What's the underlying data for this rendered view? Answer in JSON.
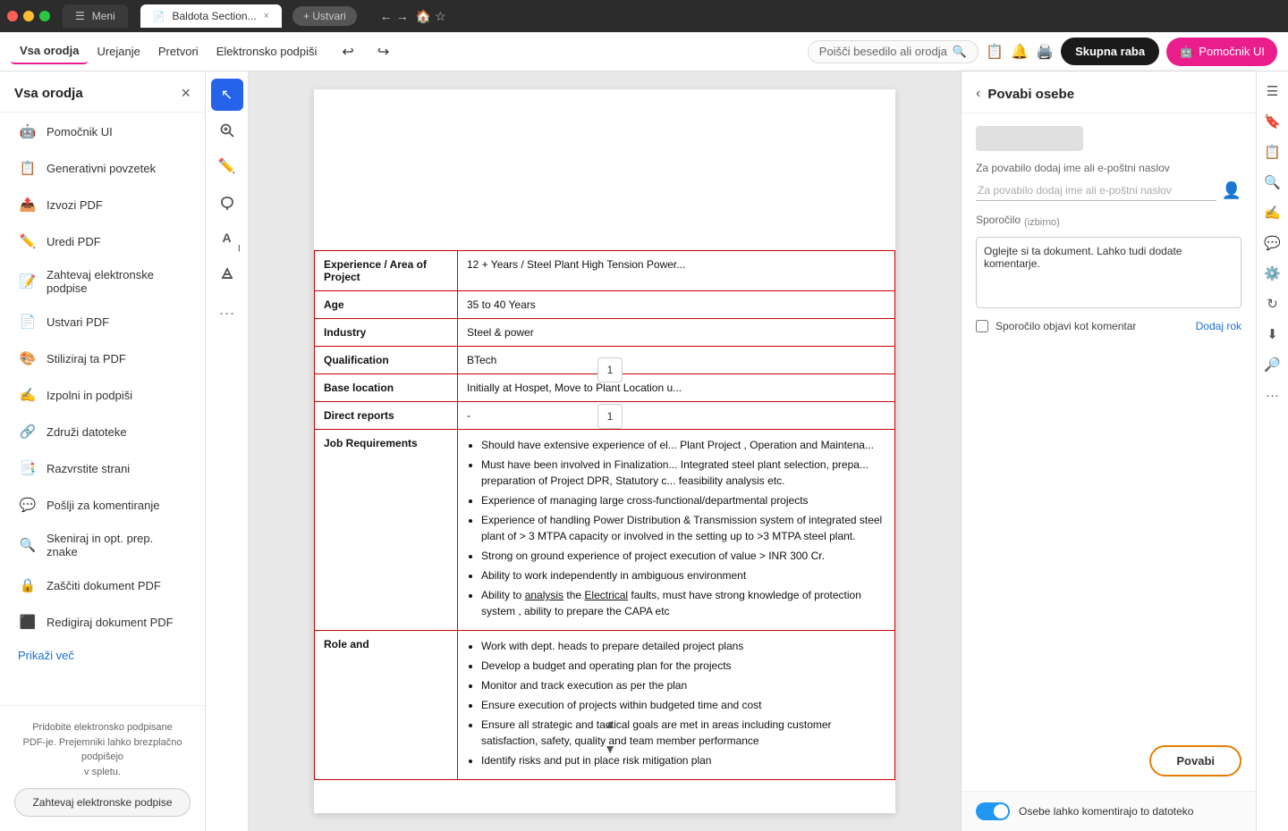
{
  "browser": {
    "tabs": [
      {
        "label": "Meni",
        "active": false
      },
      {
        "label": "Baldota Section...",
        "active": true,
        "has_close": true
      },
      {
        "new_tab_label": "+ Ustvari"
      }
    ],
    "nav": {
      "back_icon": "←",
      "forward_icon": "→"
    }
  },
  "toolbar": {
    "menu_items": [
      "Vsa orodja",
      "Urejanje",
      "Pretvori",
      "Elektronsko podpiši"
    ],
    "undo_icon": "↩",
    "redo_icon": "↪",
    "search_placeholder": "Poišči besedilo ali orodja",
    "skupna_raba_label": "Skupna raba",
    "pomocnik_label": "Pomočnik UI"
  },
  "sidebar": {
    "title": "Vsa orodja",
    "close_icon": "×",
    "items": [
      {
        "id": "pomocnik",
        "label": "Pomočnik UI",
        "icon": "🤖",
        "color": "#e91e8c"
      },
      {
        "id": "generativni",
        "label": "Generativni povzetek",
        "icon": "📋",
        "color": "#555"
      },
      {
        "id": "izvozi",
        "label": "Izvozi PDF",
        "icon": "📤",
        "color": "#555"
      },
      {
        "id": "uredi",
        "label": "Uredi PDF",
        "icon": "✏️",
        "color": "#555"
      },
      {
        "id": "zahtevaj",
        "label": "Zahtevaj elektronske podpise",
        "icon": "📝",
        "color": "#e91e8c"
      },
      {
        "id": "ustvari",
        "label": "Ustvari PDF",
        "icon": "📄",
        "color": "#555"
      },
      {
        "id": "stiliziraj",
        "label": "Stiliziraj ta PDF",
        "icon": "🎨",
        "color": "#555"
      },
      {
        "id": "izpolni",
        "label": "Izpolni in podpiši",
        "icon": "✍️",
        "color": "#555"
      },
      {
        "id": "zdruzil",
        "label": "Združi datoteke",
        "icon": "🔗",
        "color": "#555"
      },
      {
        "id": "razvrsti",
        "label": "Razvrstite strani",
        "icon": "📑",
        "color": "#555"
      },
      {
        "id": "poslji",
        "label": "Pošlji za komentiranje",
        "icon": "💬",
        "color": "#555"
      },
      {
        "id": "skeniraj",
        "label": "Skeniraj in opt. prep. znake",
        "icon": "🔍",
        "color": "#555"
      },
      {
        "id": "zasciti",
        "label": "Zaščiti dokument PDF",
        "icon": "🔒",
        "color": "#555"
      },
      {
        "id": "redigiraj",
        "label": "Redigiraj dokument PDF",
        "icon": "⬛",
        "color": "#555"
      },
      {
        "id": "pokazi_vec",
        "label": "Prikaži več",
        "icon": ""
      }
    ],
    "footer": {
      "text": "Pridobite elektronsko podpisane\nPDF-je. Prejemniki lahko brezplačno\npodpišejo\nv spletu.",
      "btn_label": "Zahtevaj elektronske podpise"
    }
  },
  "tools": [
    {
      "id": "cursor",
      "icon": "↖",
      "active": true
    },
    {
      "id": "zoom",
      "icon": "🔍",
      "active": false
    },
    {
      "id": "pen",
      "icon": "✏️",
      "active": false
    },
    {
      "id": "lasso",
      "icon": "⤾",
      "active": false
    },
    {
      "id": "text",
      "icon": "A",
      "active": false
    },
    {
      "id": "highlight",
      "icon": "✦",
      "active": false
    },
    {
      "id": "more",
      "icon": "…",
      "active": false
    }
  ],
  "pdf": {
    "table": {
      "rows": [
        {
          "label": "Experience / Area of Project",
          "value": "12 + Years / Steel Plant High Tension Power..."
        },
        {
          "label": "Age",
          "value": "35 to 40 Years"
        },
        {
          "label": "Industry",
          "value": "Steel & power"
        },
        {
          "label": "Qualification",
          "value": "BTech"
        },
        {
          "label": "Base location",
          "value": "Initially at Hospet, Move to Plant Location u..."
        },
        {
          "label": "Direct reports",
          "value": "-"
        }
      ],
      "job_requirements_label": "Job Requirements",
      "job_requirements_items": [
        "Should have extensive experience of el... Plant Project , Operation and Maintena...",
        "Must have been involved in Finalization... Integrated steel plant selection, prepa... preparation of Project DPR, Statutory c... feasibility analysis etc.",
        "Experience of managing large cross-functional/departmental projects",
        "Experience of handling Power Distribution & Transmission system of integrated steel plant of > 3 MTPA capacity or involved in the setting up to >3 MTPA steel plant.",
        "Strong on ground experience of project execution of value > INR 300 Cr.",
        "Ability to work independently in ambiguous environment",
        "Ability to analysis the Electrical faults, must have strong knowledge of protection system , ability to prepare the CAPA etc"
      ],
      "role_label": "Role and",
      "role_items": [
        "Work with dept. heads to prepare detailed project plans",
        "Develop a budget and operating plan for the projects",
        "Monitor and track execution as per the plan",
        "Ensure execution of projects within budgeted time and cost",
        "Ensure all strategic and tactical goals are met in areas including customer satisfaction, safety, quality and team member performance",
        "Identify risks and put in place risk mitigation plan"
      ]
    }
  },
  "panel": {
    "back_icon": "‹",
    "title": "Povabi osebe",
    "invite_placeholder": "Za povabilo dodaj ime ali e-poštni naslov",
    "contact_icon": "👤",
    "sporocilo_section": {
      "label": "Sporočilo (izbirno)",
      "placeholder_text": "Oglejte si ta dokument. Lahko tudi dodate komentarje."
    },
    "checkbox_label": "Sporočilo objavi kot komentar",
    "dodaj_rok_label": "Dodaj rok",
    "btn_povabi_label": "Povabi",
    "toggle_label": "Osebe lahko komentirajo to datoteko"
  },
  "right_icons": [
    "☰",
    "🔔",
    "⊞",
    "⬛",
    "📋",
    "✏️",
    "🔍",
    "⚙️",
    "📌",
    "↻",
    "⬇",
    "🔎"
  ],
  "page_indicator": {
    "current": "1",
    "total": "1"
  }
}
